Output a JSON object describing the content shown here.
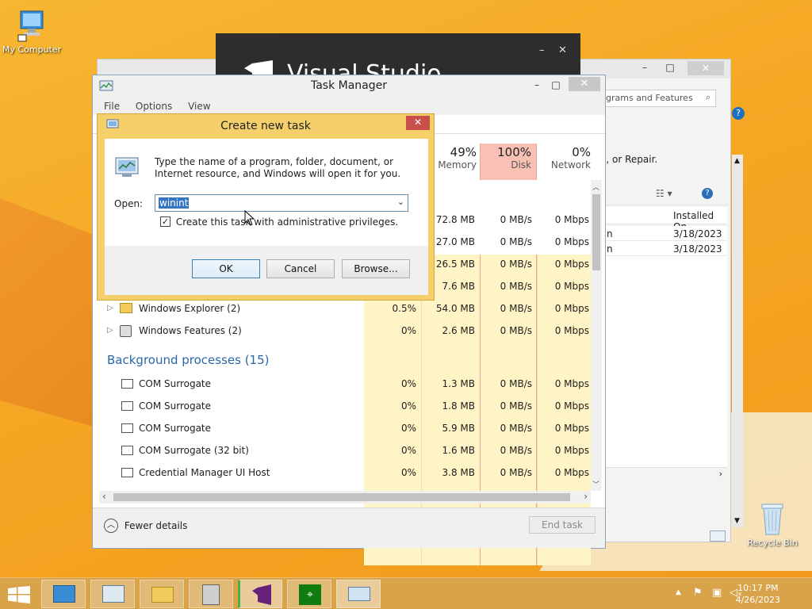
{
  "desktop": {
    "icons": [
      {
        "label": "My Computer"
      },
      {
        "label": "Recycle Bin"
      }
    ]
  },
  "vs_window": {
    "title_text": "Visual Studio",
    "minimize": "–",
    "close": "✕"
  },
  "programs_window": {
    "search_placeholder": "grams and Features",
    "hint_text": "e, or Repair.",
    "column_installed_on": "Installed On",
    "rows": [
      {
        "name": "n",
        "installed_on": "3/18/2023"
      },
      {
        "name": "n",
        "installed_on": "3/18/2023"
      }
    ]
  },
  "task_manager": {
    "title": "Task Manager",
    "menu": [
      "File",
      "Options",
      "View"
    ],
    "columns": {
      "memory": {
        "pct": "49%",
        "label": "Memory"
      },
      "disk": {
        "pct": "100%",
        "label": "Disk"
      },
      "network": {
        "pct": "0%",
        "label": "Network"
      }
    },
    "top_rows": [
      {
        "memory": "72.8 MB",
        "disk": "0 MB/s",
        "network": "0 Mbps"
      },
      {
        "memory": "27.0 MB",
        "disk": "0 MB/s",
        "network": "0 Mbps"
      },
      {
        "memory": "26.5 MB",
        "disk": "0 MB/s",
        "network": "0 Mbps"
      },
      {
        "memory": "7.6 MB",
        "disk": "0 MB/s",
        "network": "0 Mbps"
      }
    ],
    "apps": [
      {
        "name": "Windows Explorer (2)",
        "cpu": "0.5%",
        "memory": "54.0 MB",
        "disk": "0 MB/s",
        "network": "0 Mbps"
      },
      {
        "name": "Windows Features (2)",
        "cpu": "0%",
        "memory": "2.6 MB",
        "disk": "0 MB/s",
        "network": "0 Mbps"
      }
    ],
    "background_header": "Background processes (15)",
    "background": [
      {
        "name": "COM Surrogate",
        "cpu": "0%",
        "memory": "1.3 MB",
        "disk": "0 MB/s",
        "network": "0 Mbps"
      },
      {
        "name": "COM Surrogate",
        "cpu": "0%",
        "memory": "1.8 MB",
        "disk": "0 MB/s",
        "network": "0 Mbps"
      },
      {
        "name": "COM Surrogate",
        "cpu": "0%",
        "memory": "5.9 MB",
        "disk": "0 MB/s",
        "network": "0 Mbps"
      },
      {
        "name": "COM Surrogate (32 bit)",
        "cpu": "0%",
        "memory": "1.6 MB",
        "disk": "0 MB/s",
        "network": "0 Mbps"
      },
      {
        "name": "Credential Manager UI Host",
        "cpu": "0%",
        "memory": "3.8 MB",
        "disk": "0 MB/s",
        "network": "0 Mbps"
      }
    ],
    "fewer_details": "Fewer details",
    "end_task": "End task"
  },
  "dialog": {
    "title": "Create new task",
    "description": "Type the name of a program, folder, document, or Internet resource, and Windows will open it for you.",
    "open_label": "Open:",
    "open_value": "winint",
    "admin_checkbox": "Create this task with administrative privileges.",
    "admin_checked": true,
    "ok": "OK",
    "cancel": "Cancel",
    "browse": "Browse..."
  },
  "taskbar": {
    "time": "10:17 PM",
    "date": "4/26/2023"
  }
}
